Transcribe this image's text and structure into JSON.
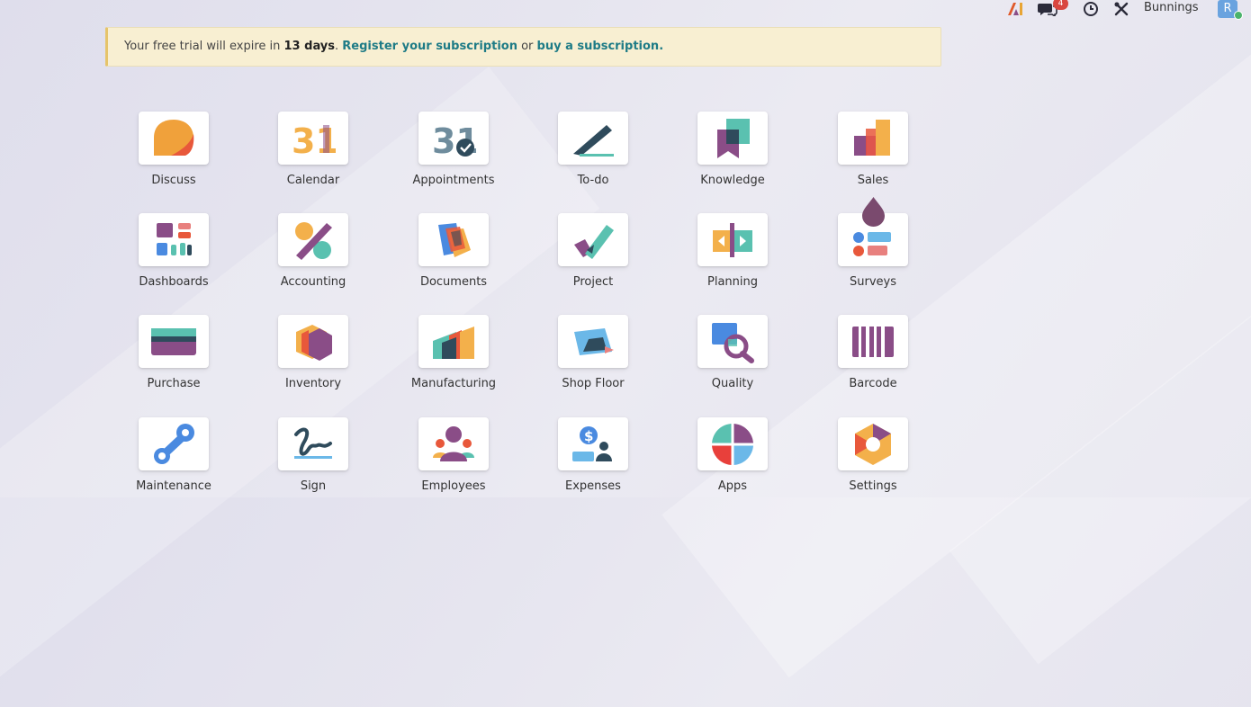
{
  "topbar": {
    "message_badge_count": "4",
    "company_name": "Bunnings",
    "user_initial": "R"
  },
  "banner": {
    "text_before": "Your free trial will expire in ",
    "days": "13 days",
    "text_dot": ". ",
    "register_link": "Register your subscription",
    "text_or": " or ",
    "buy_link": "buy a subscription",
    "text_end": "."
  },
  "apps": [
    {
      "label": "Discuss",
      "icon": "discuss-icon"
    },
    {
      "label": "Calendar",
      "icon": "calendar-icon"
    },
    {
      "label": "Appointments",
      "icon": "appointments-icon"
    },
    {
      "label": "To-do",
      "icon": "todo-icon"
    },
    {
      "label": "Knowledge",
      "icon": "knowledge-icon"
    },
    {
      "label": "Sales",
      "icon": "sales-icon"
    },
    {
      "label": "Dashboards",
      "icon": "dashboards-icon"
    },
    {
      "label": "Accounting",
      "icon": "accounting-icon"
    },
    {
      "label": "Documents",
      "icon": "documents-icon"
    },
    {
      "label": "Project",
      "icon": "project-icon"
    },
    {
      "label": "Planning",
      "icon": "planning-icon"
    },
    {
      "label": "Surveys",
      "icon": "surveys-icon"
    },
    {
      "label": "Purchase",
      "icon": "purchase-icon"
    },
    {
      "label": "Inventory",
      "icon": "inventory-icon"
    },
    {
      "label": "Manufacturing",
      "icon": "manufacturing-icon"
    },
    {
      "label": "Shop Floor",
      "icon": "shop-floor-icon"
    },
    {
      "label": "Quality",
      "icon": "quality-icon"
    },
    {
      "label": "Barcode",
      "icon": "barcode-icon"
    },
    {
      "label": "Maintenance",
      "icon": "maintenance-icon"
    },
    {
      "label": "Sign",
      "icon": "sign-icon"
    },
    {
      "label": "Employees",
      "icon": "employees-icon"
    },
    {
      "label": "Expenses",
      "icon": "expenses-icon"
    },
    {
      "label": "Apps",
      "icon": "apps-icon"
    },
    {
      "label": "Settings",
      "icon": "settings-icon"
    }
  ],
  "calendar_icon_text": "31",
  "appointments_icon_text": "31",
  "expenses_icon_symbol": "$"
}
